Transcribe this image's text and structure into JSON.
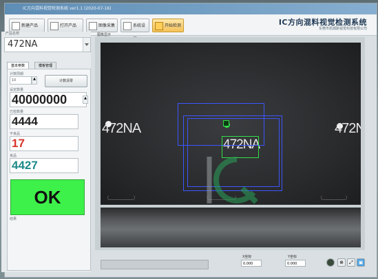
{
  "window": {
    "title": "IC方向混料视觉检测系统 ver1.1 (2020-07-16)"
  },
  "toolbar": {
    "buttons": [
      {
        "label": "新建产品"
      },
      {
        "label": "打开产品"
      },
      {
        "label": "图像采集"
      },
      {
        "label": "系统设置"
      },
      {
        "label": "开始检测"
      }
    ],
    "app_title": "IC方向混料视觉检测系统",
    "company": "东莞市凯姆斯视觉科技有限公司"
  },
  "product": {
    "label": "产品名称",
    "name": "472NA"
  },
  "tabs": [
    "基本参数",
    "模板管理"
  ],
  "params": {
    "count_cycle_label": "计数周期",
    "count_cycle_value": "10",
    "count_button": "计数清零",
    "preset_label": "设定数量",
    "preset_value": "40000000",
    "done_label": "已检数量",
    "done_value": "4444",
    "ng_label": "不良品",
    "ng_value": "17",
    "good_label": "良品",
    "good_value": "4427",
    "result": "OK",
    "result_label": "结果"
  },
  "image": {
    "label": "图像显示",
    "chips": [
      "472NA",
      "472NA",
      "472NA"
    ]
  },
  "coords": {
    "x_label": "X坐标",
    "x_value": "0.000",
    "y_label": "Y坐标",
    "y_value": "0.000"
  },
  "colors": {
    "ok_green": "#3ef04a",
    "ng_red": "#d9322b",
    "good_teal": "#1e8a8a",
    "bbox_blue": "#3d55ff",
    "match_green": "#33e048"
  },
  "icons": [
    "new-icon",
    "open-icon",
    "camera-icon",
    "settings-icon",
    "start-icon",
    "zoom-icon",
    "fit-icon",
    "monitor-icon"
  ]
}
